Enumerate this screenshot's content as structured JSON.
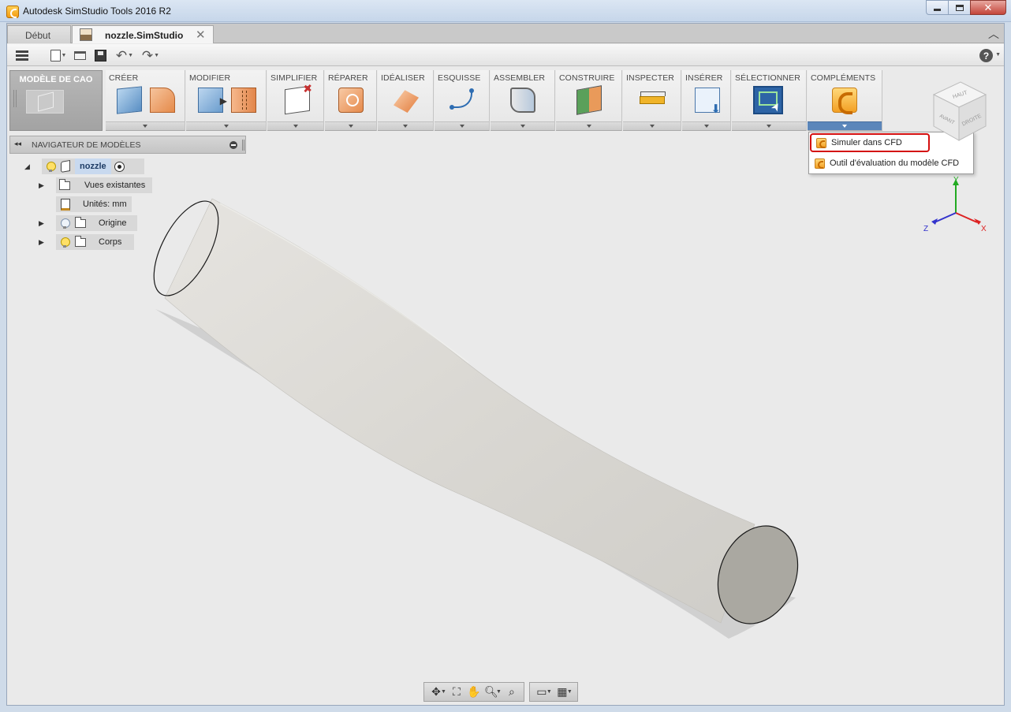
{
  "window": {
    "title": "Autodesk SimStudio Tools 2016 R2",
    "app_icon": "simstudio-app-icon",
    "controls": [
      "minimize",
      "maximize",
      "close"
    ]
  },
  "tabs": [
    {
      "label": "Début",
      "active": false
    },
    {
      "label": "nozzle.SimStudio",
      "active": true,
      "close_glyph": "✕"
    }
  ],
  "qat": {
    "icons": [
      "menu-icon",
      "new-file-icon",
      "open-folder-icon",
      "save-icon",
      "undo-icon",
      "redo-icon",
      "help-icon"
    ],
    "help_glyph": "?"
  },
  "ribbon": {
    "workspace_label": "MODÈLE DE CAO",
    "groups": [
      {
        "label": "CRÉER",
        "icons": [
          "box-icon",
          "bend-icon"
        ]
      },
      {
        "label": "MODIFIER",
        "icons": [
          "push-pull-icon",
          "split-body-icon"
        ]
      },
      {
        "label": "SIMPLIFIER",
        "icons": [
          "remove-features-icon"
        ]
      },
      {
        "label": "RÉPARER",
        "icons": [
          "repair-icon"
        ]
      },
      {
        "label": "IDÉALISER",
        "icons": [
          "idealize-surface-icon"
        ]
      },
      {
        "label": "ESQUISSE",
        "icons": [
          "sketch-curve-icon"
        ]
      },
      {
        "label": "ASSEMBLER",
        "icons": [
          "joint-icon"
        ]
      },
      {
        "label": "CONSTRUIRE",
        "icons": [
          "construct-plane-icon"
        ]
      },
      {
        "label": "INSPECTER",
        "icons": [
          "measure-icon"
        ]
      },
      {
        "label": "INSÉRER",
        "icons": [
          "insert-icon"
        ]
      },
      {
        "label": "SÉLECTIONNER",
        "icons": [
          "select-window-icon"
        ]
      },
      {
        "label": "COMPLÉMENTS",
        "icons": [
          "cfd-addin-icon"
        ],
        "expanded": true
      }
    ]
  },
  "addins_menu": {
    "items": [
      {
        "label": "Simuler dans CFD",
        "icon": "cfd-icon",
        "highlighted": true
      },
      {
        "label": "Outil d'évaluation du modèle CFD",
        "icon": "cfd-icon",
        "highlighted": false
      }
    ],
    "highlight_color": "#d40f0f"
  },
  "browser": {
    "title": "NAVIGATEUR DE MODÈLES",
    "collapse_glyph": "◂◂",
    "root": {
      "label": "nozzle",
      "expanded": true,
      "active": true
    },
    "nodes": [
      {
        "label": "Vues existantes",
        "expandable": true,
        "visibility": false,
        "icon": "folder-icon"
      },
      {
        "label": "Unités: mm",
        "expandable": false,
        "visibility": false,
        "icon": "units-icon"
      },
      {
        "label": "Origine",
        "expandable": true,
        "visibility": "hidden",
        "icon": "folder-icon"
      },
      {
        "label": "Corps",
        "expandable": true,
        "visibility": "visible",
        "icon": "folder-icon"
      }
    ]
  },
  "viewcube": {
    "faces": [
      "HAUT",
      "AVANT",
      "DROITE"
    ]
  },
  "triad": {
    "axes": [
      "Y",
      "Z",
      "X"
    ],
    "colors": {
      "x": "#d22",
      "y": "#2a2",
      "z": "#33c"
    }
  },
  "navbar": {
    "icons": [
      "orbit-icon",
      "look-at-icon",
      "pan-icon",
      "zoom-icon",
      "zoom-window-icon",
      "display-settings-icon",
      "grid-settings-icon"
    ]
  },
  "colors": {
    "accent": "#5b86ba",
    "nozzle_body": "#dcdad6",
    "nozzle_outlet_face": "#aaa8a1"
  }
}
